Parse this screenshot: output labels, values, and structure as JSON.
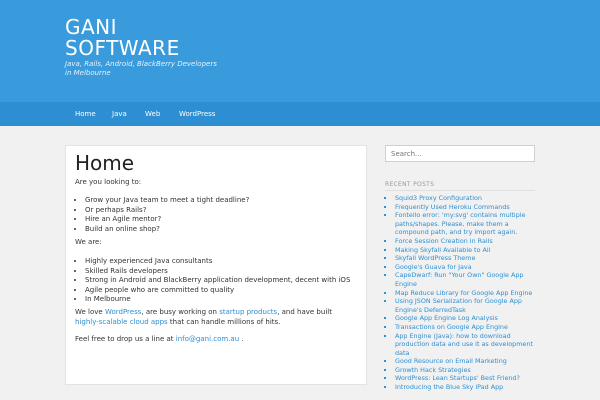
{
  "header": {
    "title": "GANI\nSOFTWARE",
    "description": "Java, Rails, Android, BlackBerry Developers in Melbourne"
  },
  "nav": [
    "Home",
    "Java",
    "Web",
    "WordPress"
  ],
  "page": {
    "title": "Home",
    "intro": "Are you looking to:",
    "looking_list": [
      "Grow your Java team to meet a tight deadline?",
      "Or perhaps Rails?",
      "Hire an Agile mentor?",
      "Build an online shop?"
    ],
    "we_are_label": "We are:",
    "we_are_list": [
      "Highly experienced Java consultants",
      "Skilled Rails developers",
      "Strong in Android and BlackBerry application development, decent with iOS",
      "Agile people who are committed to quality",
      "In Melbourne"
    ],
    "love": {
      "t1": "We love ",
      "l1": "WordPress",
      "t2": ", are busy working on ",
      "l2": "startup products",
      "t3": ", and have built ",
      "l3": "highly-scalable cloud apps",
      "t4": " that can handle millions of hits."
    },
    "contact": {
      "prefix": "Feel free to drop us a line at ",
      "email": "info@gani.com.au",
      "suffix": " ."
    }
  },
  "sidebar": {
    "search_placeholder": "Search...",
    "recent_heading": "RECENT POSTS",
    "recent_posts": [
      "Squid3 Proxy Configuration",
      "Frequently Used Heroku Commands",
      "Fontello error: 'my:svg' contains multiple paths/shapes. Please, make them a compound path, and try import again.",
      "Force Session Creation in Rails",
      "Making Skyfall Available to All",
      "Skyfall WordPress Theme",
      "Google's Guava for Java",
      "CapeDwarf: Run \"Your Own\" Google App Engine",
      "Map Reduce Library for Google App Engine",
      "Using JSON Serialization for Google App Engine's DeferredTask",
      "Google App Engine Log Analysis",
      "Transactions on Google App Engine",
      "App Engine (Java): how to download production data and use it as development data",
      "Good Resource on Email Marketing",
      "Growth Hack Strategies",
      "WordPress: Lean Startups' Best Friend?",
      "Introducing the Blue Sky iPad App"
    ]
  },
  "colors": {
    "header_bg": "#3a9bdc",
    "nav_bg": "#2d8fd1",
    "link": "#2d8fd1",
    "page_bg": "#f1f1f1"
  }
}
